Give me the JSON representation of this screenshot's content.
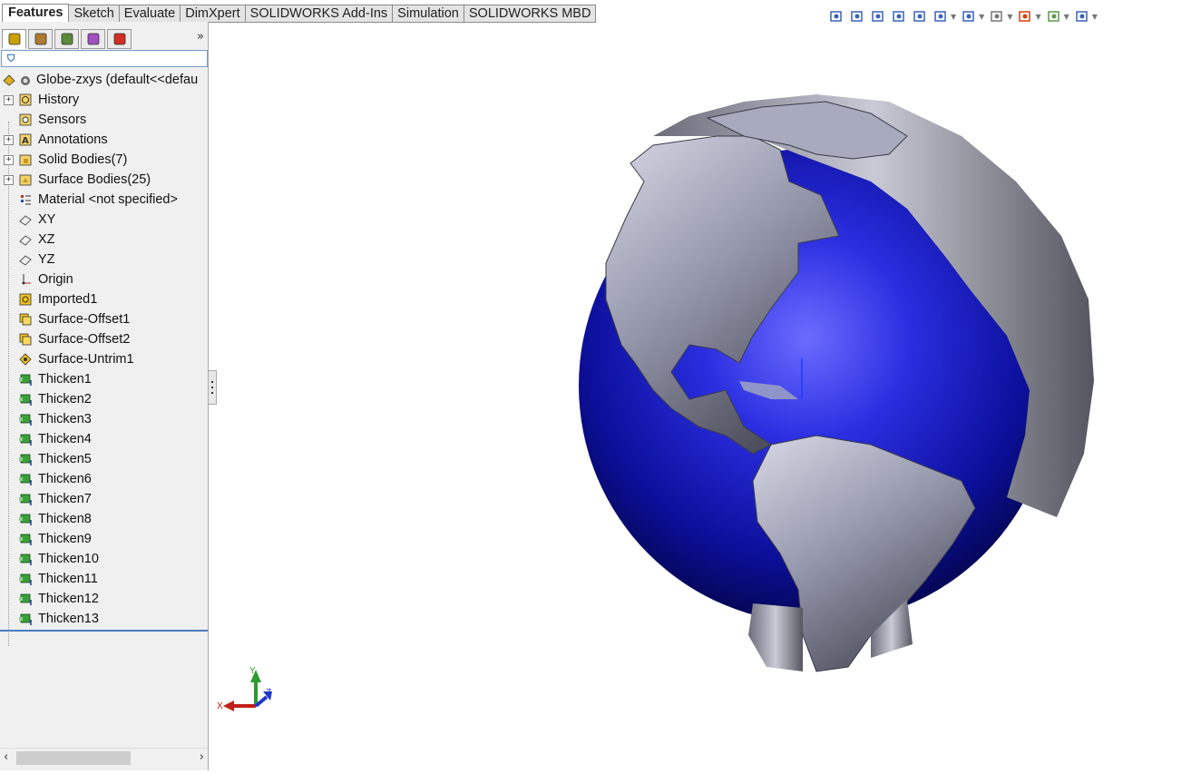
{
  "tabs": [
    "Features",
    "Sketch",
    "Evaluate",
    "DimXpert",
    "SOLIDWORKS Add-Ins",
    "Simulation",
    "SOLIDWORKS MBD"
  ],
  "active_tab": "Features",
  "view_toolbar": {
    "icons": [
      "zoom-to-fit-icon",
      "zoom-to-area-icon",
      "previous-view-icon",
      "section-view-icon",
      "dynamic-annotation-icon",
      "view-orientation-icon",
      "display-style-icon",
      "hide-show-items-icon",
      "edit-appearance-icon",
      "apply-scene-icon",
      "view-settings-icon"
    ]
  },
  "panel": {
    "tab_icons": [
      "featuremanager-icon",
      "propertymanager-icon",
      "configurationmanager-icon",
      "dimxpertmanager-icon",
      "displaymanager-icon"
    ],
    "more_label": "»"
  },
  "tree": [
    {
      "label": "Globe-zxys  (default<<defau",
      "icon": "part-icon",
      "expand": false,
      "root": true
    },
    {
      "label": "History",
      "icon": "history-icon",
      "expand": true
    },
    {
      "label": "Sensors",
      "icon": "sensors-icon",
      "expand": false
    },
    {
      "label": "Annotations",
      "icon": "annotations-icon",
      "expand": true
    },
    {
      "label": "Solid Bodies(7)",
      "icon": "solid-bodies-folder-icon",
      "expand": true
    },
    {
      "label": "Surface Bodies(25)",
      "icon": "surface-bodies-folder-icon",
      "expand": true
    },
    {
      "label": "Material <not specified>",
      "icon": "material-icon",
      "expand": false
    },
    {
      "label": "XY",
      "icon": "plane-icon",
      "expand": false
    },
    {
      "label": "XZ",
      "icon": "plane-icon",
      "expand": false
    },
    {
      "label": "YZ",
      "icon": "plane-icon",
      "expand": false
    },
    {
      "label": "Origin",
      "icon": "origin-icon",
      "expand": false
    },
    {
      "label": "Imported1",
      "icon": "imported-feature-icon",
      "expand": false
    },
    {
      "label": "Surface-Offset1",
      "icon": "surface-offset-icon",
      "expand": false
    },
    {
      "label": "Surface-Offset2",
      "icon": "surface-offset-icon",
      "expand": false
    },
    {
      "label": "Surface-Untrim1",
      "icon": "surface-untrim-icon",
      "expand": false
    },
    {
      "label": "Thicken1",
      "icon": "thicken-icon",
      "expand": false
    },
    {
      "label": "Thicken2",
      "icon": "thicken-icon",
      "expand": false
    },
    {
      "label": "Thicken3",
      "icon": "thicken-icon",
      "expand": false
    },
    {
      "label": "Thicken4",
      "icon": "thicken-icon",
      "expand": false
    },
    {
      "label": "Thicken5",
      "icon": "thicken-icon",
      "expand": false
    },
    {
      "label": "Thicken6",
      "icon": "thicken-icon",
      "expand": false
    },
    {
      "label": "Thicken7",
      "icon": "thicken-icon",
      "expand": false
    },
    {
      "label": "Thicken8",
      "icon": "thicken-icon",
      "expand": false
    },
    {
      "label": "Thicken9",
      "icon": "thicken-icon",
      "expand": false
    },
    {
      "label": "Thicken10",
      "icon": "thicken-icon",
      "expand": false
    },
    {
      "label": "Thicken11",
      "icon": "thicken-icon",
      "expand": false
    },
    {
      "label": "Thicken12",
      "icon": "thicken-icon",
      "expand": false
    },
    {
      "label": "Thicken13",
      "icon": "thicken-icon",
      "expand": false
    }
  ],
  "triad": {
    "x": "X",
    "y": "Y",
    "z": "Z"
  },
  "colors": {
    "ocean": "#1a1fc0",
    "land": "#9a9cae",
    "x_axis": "#c0201a",
    "y_axis": "#2e9a2e",
    "z_axis": "#2036c8",
    "tree_selection": "#4b7dbf"
  }
}
